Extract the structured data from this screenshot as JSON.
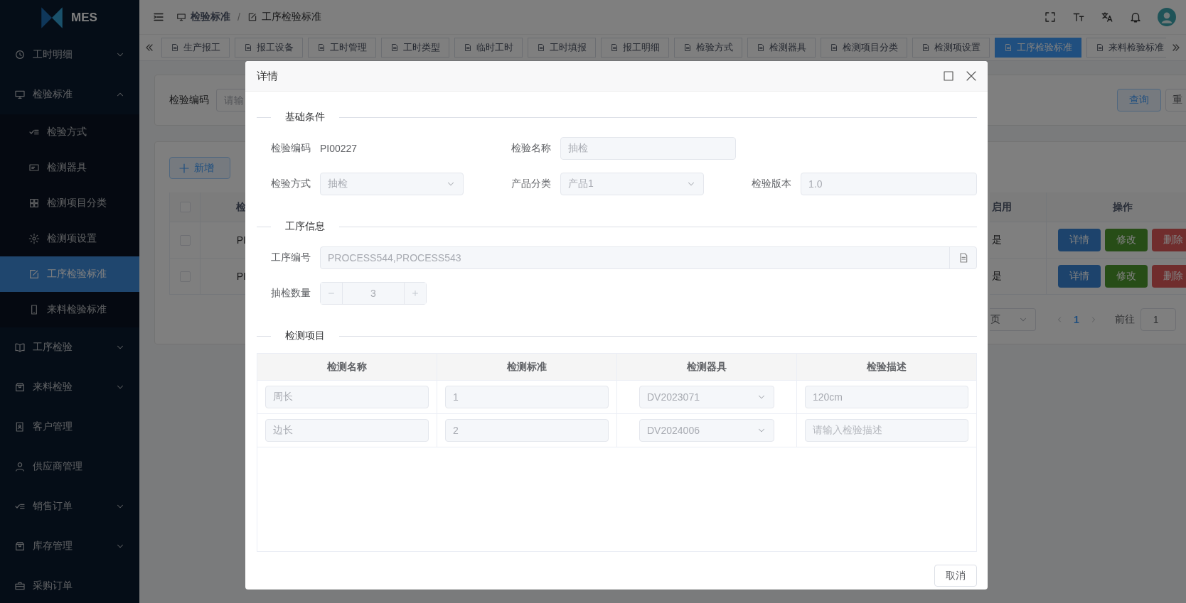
{
  "sidebar": {
    "logo_text": "MES",
    "items": [
      {
        "label": "工时明细",
        "kind": "group",
        "expanded": false
      },
      {
        "label": "检验标准",
        "kind": "group",
        "expanded": true,
        "children": [
          {
            "label": "检验方式",
            "selected": false
          },
          {
            "label": "检测器具",
            "selected": false
          },
          {
            "label": "检测项目分类",
            "selected": false
          },
          {
            "label": "检测项设置",
            "selected": false
          },
          {
            "label": "工序检验标准",
            "selected": true
          },
          {
            "label": "来料检验标准",
            "selected": false
          }
        ]
      },
      {
        "label": "工序检验",
        "kind": "group",
        "expanded": false
      },
      {
        "label": "来料检验",
        "kind": "group",
        "expanded": false
      },
      {
        "label": "客户管理",
        "kind": "link"
      },
      {
        "label": "供应商管理",
        "kind": "link"
      },
      {
        "label": "销售订单",
        "kind": "group",
        "expanded": false
      },
      {
        "label": "库存管理",
        "kind": "group",
        "expanded": false
      },
      {
        "label": "采购订单",
        "kind": "link"
      }
    ]
  },
  "header": {
    "breadcrumb": [
      "检验标准",
      "工序检验标准"
    ],
    "separator": "/"
  },
  "tabs": [
    {
      "label": "生产报工",
      "selected": false
    },
    {
      "label": "报工设备",
      "selected": false
    },
    {
      "label": "工时管理",
      "selected": false
    },
    {
      "label": "工时类型",
      "selected": false
    },
    {
      "label": "临时工时",
      "selected": false
    },
    {
      "label": "工时填报",
      "selected": false
    },
    {
      "label": "报工明细",
      "selected": false
    },
    {
      "label": "检验方式",
      "selected": false
    },
    {
      "label": "检测器具",
      "selected": false
    },
    {
      "label": "检测项目分类",
      "selected": false
    },
    {
      "label": "检测项设置",
      "selected": false
    },
    {
      "label": "工序检验标准",
      "selected": true
    },
    {
      "label": "来料检验标准",
      "selected": false
    }
  ],
  "search": {
    "label": "检验编码",
    "placeholder": "请输",
    "query_button": "查询",
    "reset_button": "重"
  },
  "list": {
    "add_button": "新增",
    "header_checked": false,
    "column_code": "检",
    "column_enabled": "启用",
    "column_actions": "操作",
    "rows": [
      {
        "checked": false,
        "code": "PI",
        "enabled": "是",
        "actions": [
          "详情",
          "修改",
          "删除"
        ]
      },
      {
        "checked": false,
        "code": "PI",
        "enabled": "是",
        "actions": [
          "详情",
          "修改",
          "删除"
        ]
      }
    ],
    "pagination": {
      "page_size": "页",
      "current_page": "1",
      "goto_label": "前往",
      "goto_value": "1"
    }
  },
  "dialog": {
    "title": "详情",
    "basic": {
      "heading": "基础条件",
      "code_label": "检验编码",
      "code": "PI00227",
      "name_label": "检验名称",
      "name": "抽检",
      "method_label": "检验方式",
      "method": "抽检",
      "category_label": "产品分类",
      "category": "产品1",
      "version_label": "检验版本",
      "version": "1.0"
    },
    "process": {
      "heading": "工序信息",
      "process_label": "工序编号",
      "process": "PROCESS544,PROCESS543",
      "qty_label": "抽检数量",
      "qty": "3"
    },
    "items": {
      "heading": "检测项目",
      "columns": [
        "检测名称",
        "检测标准",
        "检测器具",
        "检验描述"
      ],
      "rows": [
        {
          "name": "周长",
          "standard": "1",
          "instrument": "DV2023071",
          "description": "120cm"
        },
        {
          "name": "边长",
          "standard": "2",
          "instrument": "DV2024006",
          "placeholder": "请输入检验描述"
        }
      ]
    },
    "cancel_button": "取消"
  }
}
